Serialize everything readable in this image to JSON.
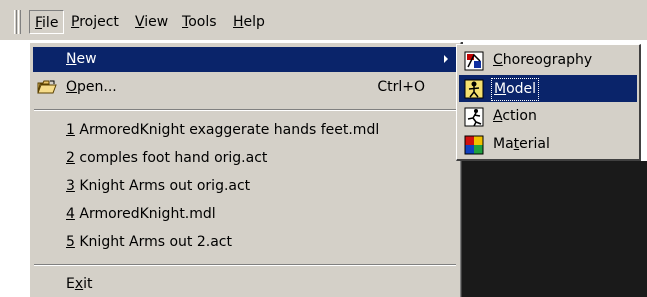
{
  "menubar": {
    "items": [
      {
        "label": "File",
        "accel": "F"
      },
      {
        "label": "Project",
        "accel": "P"
      },
      {
        "label": "View",
        "accel": "V"
      },
      {
        "label": "Tools",
        "accel": "T"
      },
      {
        "label": "Help",
        "accel": "H"
      }
    ]
  },
  "file_menu": {
    "new": {
      "label": "New",
      "accel": "N",
      "highlighted": true
    },
    "open": {
      "label": "Open...",
      "accel": "O",
      "shortcut": "Ctrl+O",
      "icon": "open-folder-icon"
    },
    "recent": [
      {
        "num": "1",
        "label": " ArmoredKnight exaggerate hands feet.mdl"
      },
      {
        "num": "2",
        "label": " comples foot hand orig.act"
      },
      {
        "num": "3",
        "label": " Knight Arms out orig.act"
      },
      {
        "num": "4",
        "label": " ArmoredKnight.mdl"
      },
      {
        "num": "5",
        "label": " Knight Arms out 2.act"
      }
    ],
    "exit": {
      "label": "Exit",
      "accel": "x"
    }
  },
  "new_submenu": {
    "items": [
      {
        "label": "Choreography",
        "accel": "C",
        "icon": "choreography-icon",
        "highlighted": false
      },
      {
        "label": "Model",
        "accel": "M",
        "icon": "model-icon",
        "highlighted": true
      },
      {
        "label": "Action",
        "accel": "A",
        "icon": "action-icon",
        "highlighted": false
      },
      {
        "label": "Material",
        "accel": "t",
        "icon": "material-icon",
        "highlighted": false
      }
    ]
  },
  "colors": {
    "menu_face": "#d4d0c8",
    "highlight": "#0a246a",
    "highlight_text": "#ffffff"
  }
}
